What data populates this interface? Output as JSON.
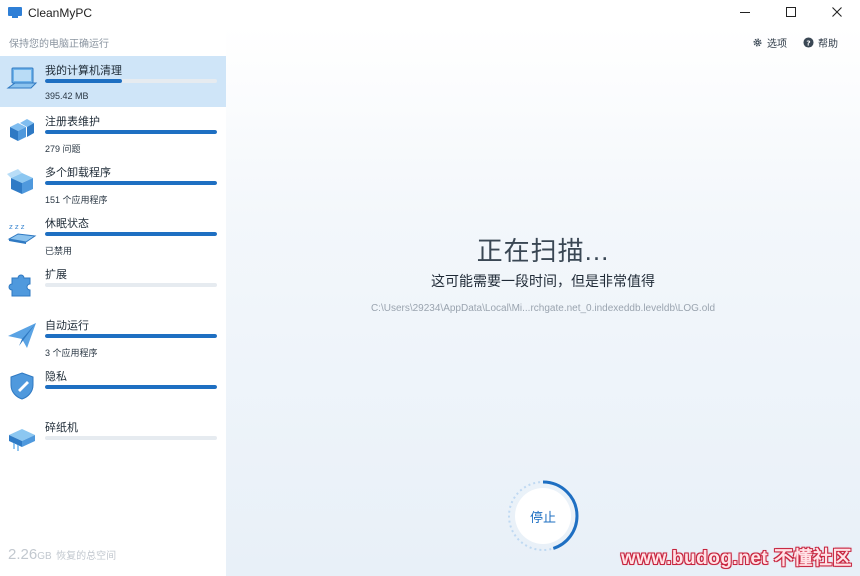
{
  "app": {
    "title": "CleanMyPC",
    "tagline": "保持您的电脑正确运行"
  },
  "window_controls": {
    "minimize": "—",
    "maximize": "☐",
    "close": "✕"
  },
  "toolbar": {
    "options_label": "选项",
    "help_label": "帮助"
  },
  "sidebar": {
    "items": [
      {
        "label": "我的计算机清理",
        "sub": "395.42 MB",
        "progress": 0.45,
        "active": true,
        "icon": "computer-icon"
      },
      {
        "label": "注册表维护",
        "sub": "279 问题",
        "progress": 1.0,
        "active": false,
        "icon": "registry-blocks-icon"
      },
      {
        "label": "多个卸载程序",
        "sub": "151 个应用程序",
        "progress": 1.0,
        "active": false,
        "icon": "uninstaller-box-icon"
      },
      {
        "label": "休眠状态",
        "sub": "已禁用",
        "progress": 1.0,
        "active": false,
        "icon": "hibernation-laptop-icon"
      },
      {
        "label": "扩展",
        "sub": "",
        "progress": 0.0,
        "active": false,
        "icon": "puzzle-icon"
      },
      {
        "label": "自动运行",
        "sub": "3 个应用程序",
        "progress": 1.0,
        "active": false,
        "icon": "paper-plane-icon"
      },
      {
        "label": "隐私",
        "sub": "",
        "progress": 1.0,
        "active": false,
        "icon": "shield-icon"
      },
      {
        "label": "碎纸机",
        "sub": "",
        "progress": 0.0,
        "active": false,
        "icon": "shredder-icon"
      }
    ],
    "footer": {
      "amount": "2.26",
      "unit": "GB",
      "text": "恢复的总空间"
    }
  },
  "main": {
    "scan_title": "正在扫描...",
    "scan_subtitle": "这可能需要一段时间，但是非常值得",
    "scan_path": "C:\\Users\\29234\\AppData\\Local\\Mi...rchgate.net_0.indexeddb.leveldb\\LOG.old",
    "stop_label": "停止",
    "scan_progress": 0.45
  },
  "watermark": "www.budog.net 不懂社区",
  "colors": {
    "accent": "#1e6fc2",
    "active_bg": "#cfe5f8",
    "track": "#e6ebf0"
  }
}
